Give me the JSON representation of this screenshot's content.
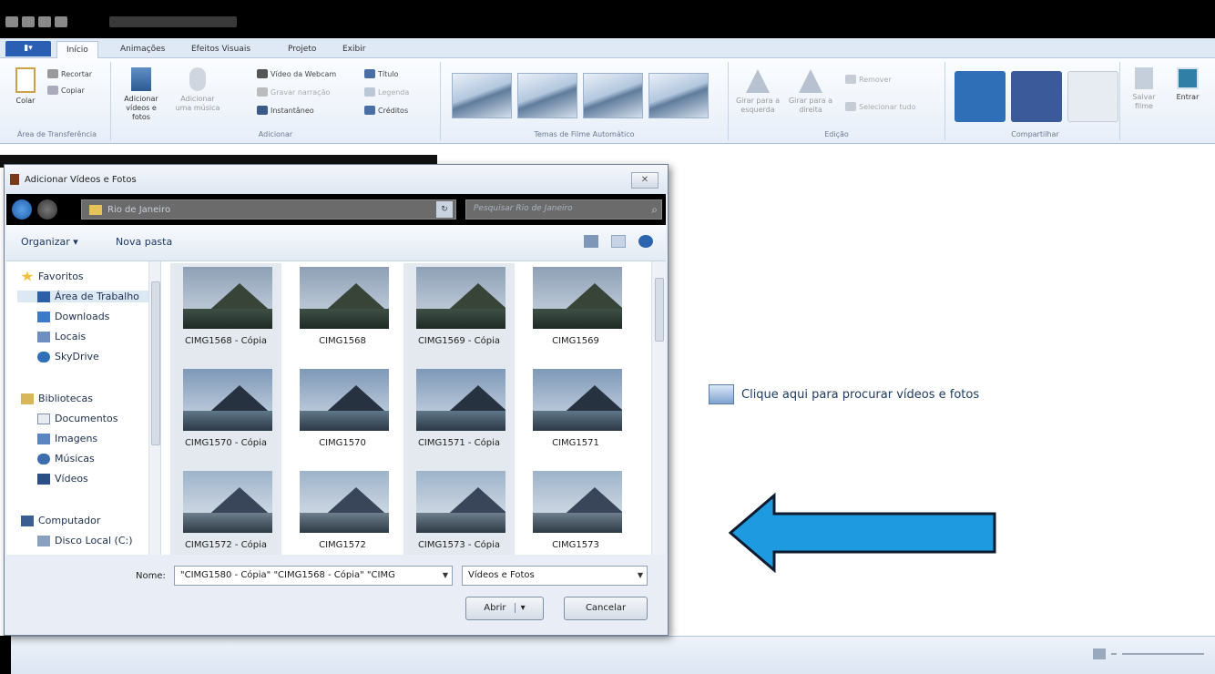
{
  "ribbon": {
    "file_tab": "▮▾",
    "tabs": [
      "Início",
      "Animações",
      "Efeitos Visuais",
      "Projeto",
      "Exibir"
    ],
    "clipboard": {
      "paste": "Colar",
      "cut": "Recortar",
      "copy": "Copiar",
      "label": "Área de Transferência"
    },
    "add": {
      "add_videos": "Adicionar vídeos e fotos",
      "add_music": "Adicionar uma música",
      "webcam": "Vídeo da Webcam",
      "narration": "Gravar narração",
      "snapshot": "Instantâneo",
      "title": "Título",
      "caption": "Legenda",
      "credits": "Créditos",
      "label": "Adicionar"
    },
    "themes_label": "Temas de Filme Automático",
    "edit": {
      "rotate_left": "Girar para a esquerda",
      "rotate_right": "Girar para a direita",
      "remove": "Remover",
      "select_all": "Selecionar tudo",
      "label": "Edição"
    },
    "share_label": "Compartilhar",
    "save_movie": "Salvar filme",
    "sign_in": "Entrar"
  },
  "main": {
    "click_here": "Clique aqui para procurar vídeos e fotos"
  },
  "dialog": {
    "title": "Adicionar Vídeos e Fotos",
    "close": "✕",
    "address": "Rio de Janeiro",
    "search_placeholder": "Pesquisar Rio de Janeiro",
    "organize": "Organizar ▾",
    "new_folder": "Nova pasta",
    "nav": [
      {
        "label": "Favoritos",
        "icon": "star-icon"
      },
      {
        "label": "Área de Trabalho",
        "icon": "desktop-icon"
      },
      {
        "label": "Downloads",
        "icon": "downloads-icon"
      },
      {
        "label": "Locais",
        "icon": "places-icon"
      },
      {
        "label": "SkyDrive",
        "icon": "skydrive-icon"
      },
      {
        "label": "Bibliotecas",
        "icon": "libraries-icon"
      },
      {
        "label": "Documentos",
        "icon": "documents-icon"
      },
      {
        "label": "Imagens",
        "icon": "images-icon"
      },
      {
        "label": "Músicas",
        "icon": "music-icon"
      },
      {
        "label": "Vídeos",
        "icon": "videos-icon"
      },
      {
        "label": "Computador",
        "icon": "computer-icon"
      },
      {
        "label": "Disco Local (C:)",
        "icon": "disk-icon"
      }
    ],
    "files": [
      "CIMG1568 - Cópia",
      "CIMG1568",
      "CIMG1569 - Cópia",
      "CIMG1569",
      "CIMG1570 - Cópia",
      "CIMG1570",
      "CIMG1571 - Cópia",
      "CIMG1571",
      "CIMG1572 - Cópia",
      "CIMG1572",
      "CIMG1573 - Cópia",
      "CIMG1573"
    ],
    "filename_label": "Nome:",
    "filename_value": "\"CIMG1580 - Cópia\" \"CIMG1568 - Cópia\" \"CIMG",
    "filetype": "Vídeos e Fotos",
    "open": "Abrir",
    "cancel": "Cancelar"
  },
  "colors": {
    "accent": "#2b5fb3",
    "arrow": "#1e9be0"
  }
}
